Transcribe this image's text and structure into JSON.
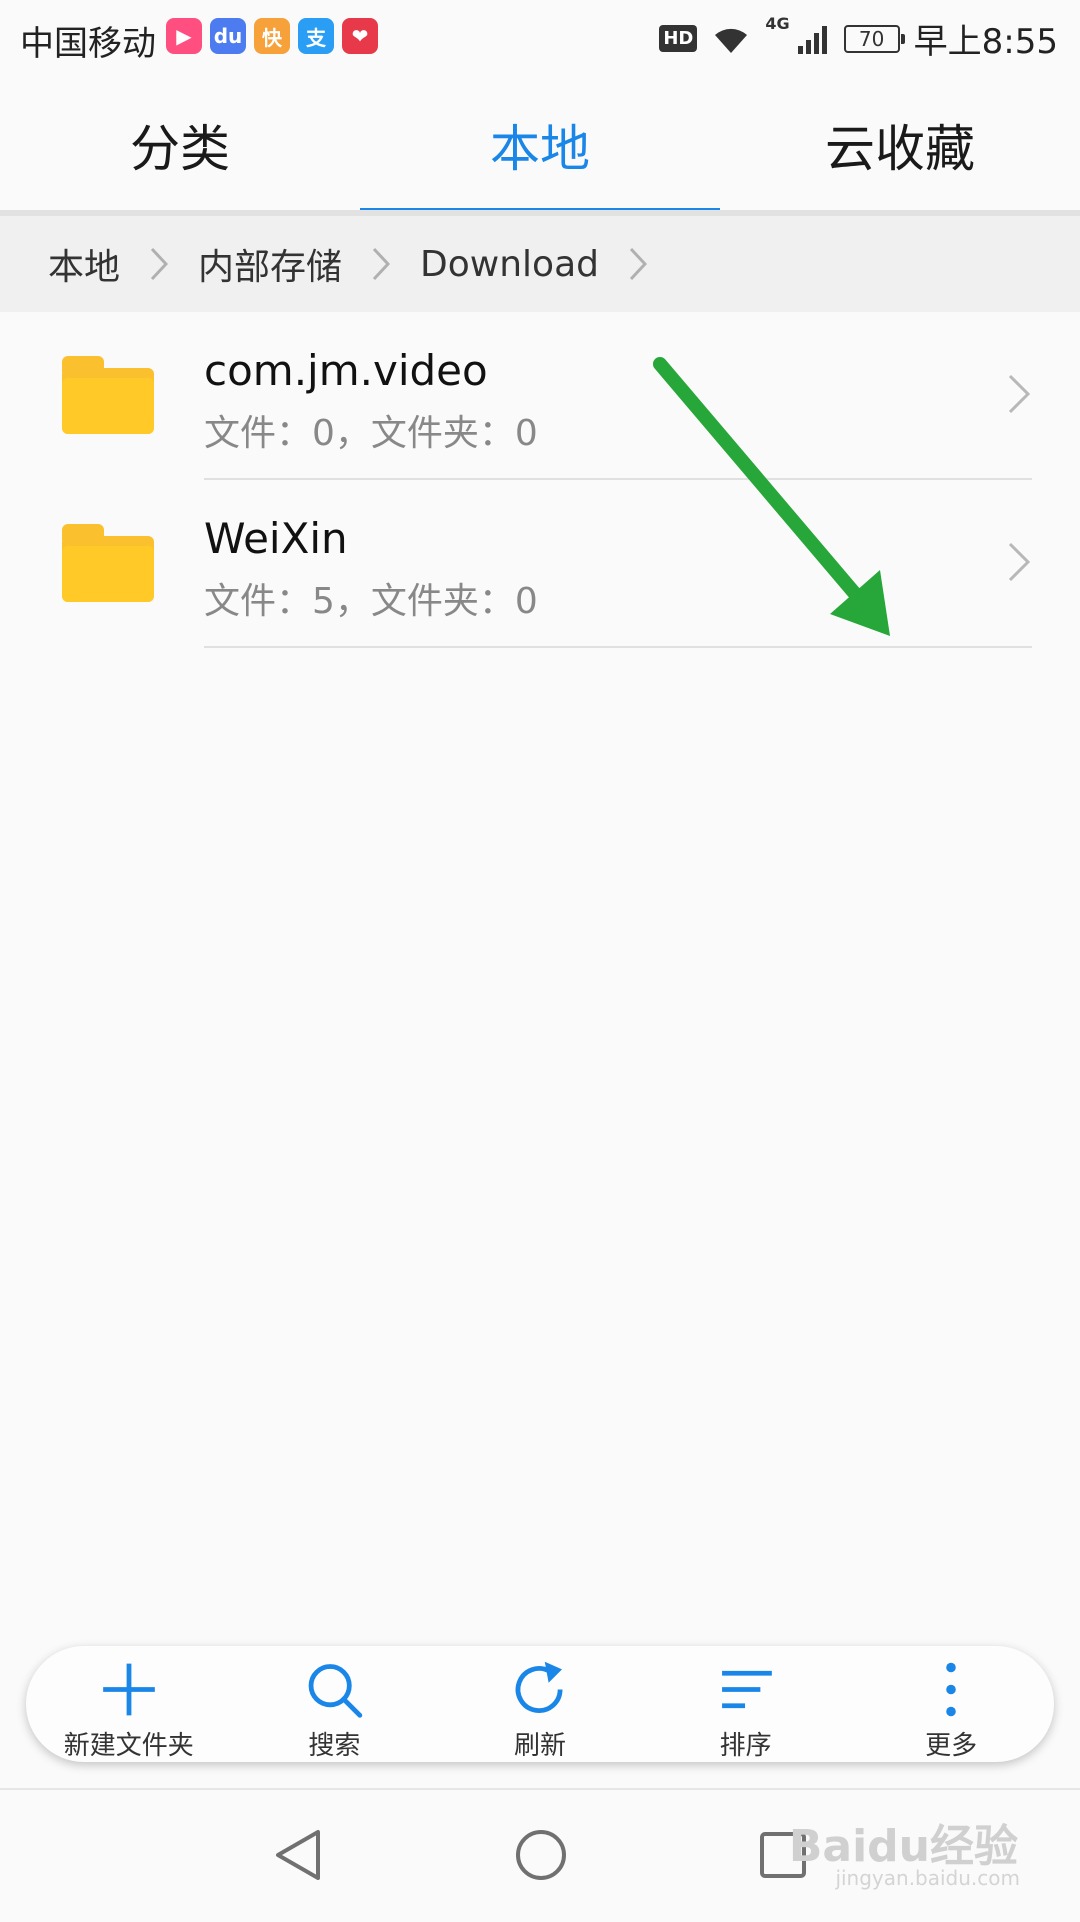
{
  "status_bar": {
    "carrier": "中国移动",
    "app_icons": [
      {
        "name": "video-app-icon",
        "glyph": "▶",
        "color": "#ff4f81"
      },
      {
        "name": "baidu-app-icon",
        "glyph": "du",
        "color": "#4d7cf0"
      },
      {
        "name": "kuai-app-icon",
        "glyph": "快",
        "color": "#f7a13a"
      },
      {
        "name": "alipay-app-icon",
        "glyph": "支",
        "color": "#2a9df4"
      },
      {
        "name": "gift-app-icon",
        "glyph": "❤",
        "color": "#e8394a"
      }
    ],
    "hd_label": "HD",
    "network_label": "4G",
    "battery": "70",
    "time": "早上8:55"
  },
  "tabs": [
    {
      "label": "分类",
      "active": false
    },
    {
      "label": "本地",
      "active": true
    },
    {
      "label": "云收藏",
      "active": false
    }
  ],
  "breadcrumb": [
    "本地",
    "内部存储",
    "Download"
  ],
  "folders": [
    {
      "name": "com.jm.video",
      "info": "文件：0，文件夹：0"
    },
    {
      "name": "WeiXin",
      "info": "文件：5，文件夹：0"
    }
  ],
  "toolbar": [
    {
      "label": "新建文件夹",
      "icon": "plus-icon"
    },
    {
      "label": "搜索",
      "icon": "search-icon"
    },
    {
      "label": "刷新",
      "icon": "refresh-icon"
    },
    {
      "label": "排序",
      "icon": "sort-icon"
    },
    {
      "label": "更多",
      "icon": "more-vertical-icon"
    }
  ],
  "colors": {
    "accent": "#1a86e8",
    "folder": "#ffca28",
    "annotation_arrow": "#27a639"
  },
  "watermark": {
    "text": "Baidu经验",
    "sub": "jingyan.baidu.com"
  }
}
